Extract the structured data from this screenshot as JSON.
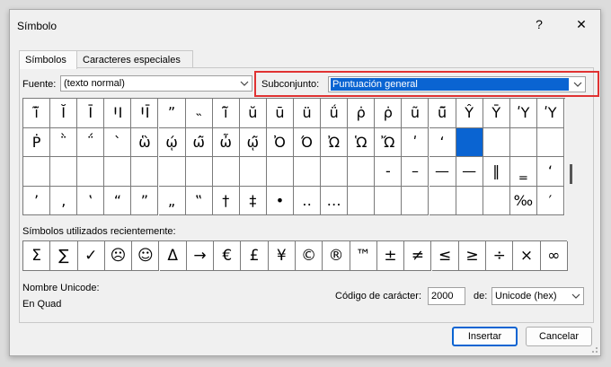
{
  "window": {
    "title": "Símbolo",
    "help_glyph": "?",
    "close_glyph": "✕"
  },
  "tabs": [
    {
      "label": "Símbolos"
    },
    {
      "label": "Caracteres especiales"
    }
  ],
  "font": {
    "label": "Fuente:",
    "value": "(texto normal)"
  },
  "subset": {
    "label": "Subconjunto:",
    "value": "Puntuación general"
  },
  "symbol_grid": {
    "rows": [
      [
        "ĩ̃",
        "Ĭ",
        "Ī",
        "ꞋI",
        "ꞋĪ",
        "ˮ",
        "˵",
        "ĩ̑",
        "ŭ",
        "ū",
        "ü",
        "ǘ",
        "ρ̇",
        "ρ̇",
        "ũ",
        "ũ̃",
        "Ŷ",
        "Ȳ",
        "ʹΥ",
        "ʹΥ"
      ],
      [
        "Ṗ",
        "῭",
        "΅",
        "`",
        "ὣ",
        "ῴ",
        "ώ̃",
        "ὦ",
        "ῴ̃",
        "Ὀ",
        "Ό",
        "Ὠ",
        "Ὡ",
        "Ὤ",
        "ʹ",
        "ʻ",
        "",
        "",
        "",
        ""
      ],
      [
        "",
        "",
        "",
        "",
        "",
        "",
        "",
        "",
        "",
        "",
        "",
        "",
        "",
        "-",
        "–",
        "—",
        "—",
        "‖",
        "‗",
        "‘"
      ],
      [
        "’",
        "‚",
        "‛",
        "“",
        "”",
        "„",
        "‟",
        "†",
        "‡",
        "•",
        "‥",
        "…",
        "",
        "",
        "",
        "",
        "",
        "",
        "‰",
        "′"
      ]
    ],
    "selected_cell": "row 2, column 14"
  },
  "recent": {
    "label": "Símbolos utilizados recientemente:",
    "symbols": [
      "Σ",
      "∑",
      "✓",
      "☹",
      "☺",
      "Δ",
      "→",
      "€",
      "£",
      "¥",
      "©",
      "®",
      "™",
      "±",
      "≠",
      "≤",
      "≥",
      "÷",
      "×",
      "∞"
    ]
  },
  "unicode_name": {
    "label": "Nombre Unicode:",
    "value": "En Quad"
  },
  "char_code": {
    "label": "Código de carácter:",
    "value": "2000"
  },
  "from": {
    "label": "de:",
    "value": "Unicode (hex)"
  },
  "buttons": {
    "insert": "Insertar",
    "cancel": "Cancelar"
  },
  "icons": {
    "dropdown": "chevron-down-icon",
    "close": "close-icon",
    "help": "help-icon"
  },
  "colors": {
    "selection": "#0a64d2",
    "highlight_border": "#e03232"
  }
}
